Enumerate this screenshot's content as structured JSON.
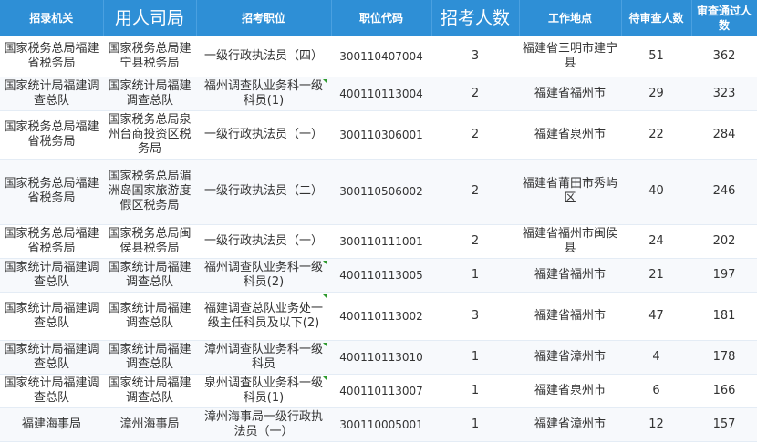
{
  "table": {
    "headers": {
      "agency": "招录机关",
      "unit": "用人司局",
      "position": "招考职位",
      "code": "职位代码",
      "quota": "招考人数",
      "location": "工作地点",
      "pending": "待审查人数",
      "passed": "审查通过人数"
    },
    "rows": [
      {
        "agency": "国家税务总局福建省税务局",
        "unit": "国家税务总局建宁县税务局",
        "position": "一级行政执法员（四）",
        "code": "300110407004",
        "quota": "3",
        "location": "福建省三明市建宁县",
        "pending": "51",
        "passed": "362"
      },
      {
        "agency": "国家统计局福建调查总队",
        "unit": "国家统计局福建调查总队",
        "position": "福州调查队业务科一级科员(1)",
        "code": "400110113004",
        "quota": "2",
        "location": "福建省福州市",
        "pending": "29",
        "passed": "323"
      },
      {
        "agency": "国家税务总局福建省税务局",
        "unit": "国家税务总局泉州台商投资区税务局",
        "position": "一级行政执法员（一）",
        "code": "300110306001",
        "quota": "2",
        "location": "福建省泉州市",
        "pending": "22",
        "passed": "284"
      },
      {
        "agency": "国家税务总局福建省税务局",
        "unit": "国家税务总局湄洲岛国家旅游度假区税务局",
        "position": "一级行政执法员（二）",
        "code": "300110506002",
        "quota": "2",
        "location": "福建省莆田市秀屿区",
        "pending": "40",
        "passed": "246"
      },
      {
        "agency": "国家税务总局福建省税务局",
        "unit": "国家税务总局闽侯县税务局",
        "position": "一级行政执法员（一）",
        "code": "300110111001",
        "quota": "2",
        "location": "福建省福州市闽侯县",
        "pending": "24",
        "passed": "202"
      },
      {
        "agency": "国家统计局福建调查总队",
        "unit": "国家统计局福建调查总队",
        "position": "福州调查队业务科一级科员(2)",
        "code": "400110113005",
        "quota": "1",
        "location": "福建省福州市",
        "pending": "21",
        "passed": "197"
      },
      {
        "agency": "国家统计局福建调查总队",
        "unit": "国家统计局福建调查总队",
        "position": "福建调查总队业务处一级主任科员及以下(2)",
        "code": "400110113002",
        "quota": "3",
        "location": "福建省福州市",
        "pending": "47",
        "passed": "181"
      },
      {
        "agency": "国家统计局福建调查总队",
        "unit": "国家统计局福建调查总队",
        "position": "漳州调查队业务科一级科员",
        "code": "400110113010",
        "quota": "1",
        "location": "福建省漳州市",
        "pending": "4",
        "passed": "178"
      },
      {
        "agency": "国家统计局福建调查总队",
        "unit": "国家统计局福建调查总队",
        "position": "泉州调查队业务科一级科员(1)",
        "code": "400110113007",
        "quota": "1",
        "location": "福建省泉州市",
        "pending": "6",
        "passed": "166"
      },
      {
        "agency": "福建海事局",
        "unit": "漳州海事局",
        "position": "漳州海事局一级行政执法员（一）",
        "code": "300110005001",
        "quota": "1",
        "location": "福建省漳州市",
        "pending": "12",
        "passed": "157"
      }
    ]
  },
  "colors": {
    "header_bg": "#2e8fd6",
    "header_text": "#ffffff",
    "flag": "#2e9a2e"
  }
}
